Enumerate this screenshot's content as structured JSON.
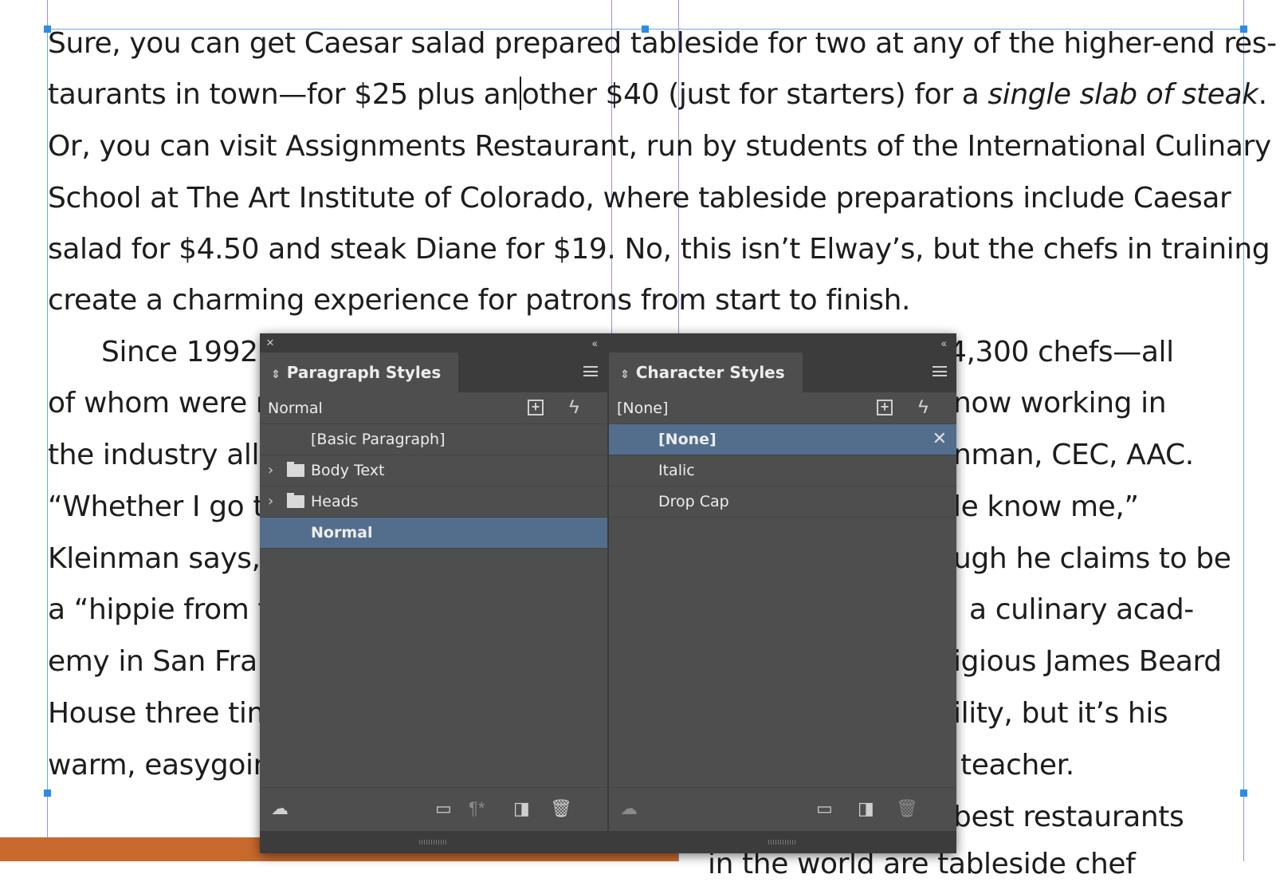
{
  "document": {
    "lines_top": [
      {
        "text": "Sure, you can get Caesar salad prepared tableside for two at any of the higher-end res-"
      },
      {
        "before": "taurants in town—for $25 plus an",
        "after": "other $40 (just for starters) for a ",
        "italic": "single slab of steak",
        "tail": "."
      },
      {
        "text": "Or, you can visit Assignments Restaurant, run by students of the International Culinary"
      },
      {
        "text": "School at The Art Institute of Colorado, where tableside preparations include Caesar"
      },
      {
        "text": "salad for $4.50 and steak Diane for $19. No, this isn’t Elway’s, but the chefs in training"
      },
      {
        "text": "create a charming experience for patrons from start to finish."
      }
    ],
    "lines_left": [
      "Since 1992,",
      "of whom were r",
      "the industry all",
      "“Whether I go t",
      "Kleinman says, c",
      "a “hippie from t",
      "emy in San Fran",
      "House three tim",
      "warm, easygoin"
    ],
    "lines_right": [
      "4,300 chefs—all",
      "now working in",
      "nman, CEC, AAC.",
      "le know me,”",
      "ugh he claims to be",
      "a culinary acad-",
      "igious James Beard",
      "ility, but it’s his",
      "teacher.",
      "best restaurants",
      "in the world are tableside chef"
    ]
  },
  "panels": {
    "close_glyph": "×",
    "collapse_glyph": "‹‹",
    "paragraph_styles": {
      "tab_label": "Paragraph Styles",
      "current_style": "Normal",
      "items": [
        {
          "label": "[Basic Paragraph]",
          "type": "style"
        },
        {
          "label": "Body Text",
          "type": "folder"
        },
        {
          "label": "Heads",
          "type": "folder"
        },
        {
          "label": "Normal",
          "type": "style",
          "selected": true
        }
      ]
    },
    "character_styles": {
      "tab_label": "Character Styles",
      "current_style": "[None]",
      "items": [
        {
          "label": "[None]",
          "type": "style",
          "selected": true
        },
        {
          "label": "Italic",
          "type": "style"
        },
        {
          "label": "Drop Cap",
          "type": "style"
        }
      ]
    }
  },
  "icons": {
    "updown": "⇕",
    "menu": "menu-icon",
    "new_group": "+",
    "quick_apply": "ϟ",
    "chevron": "›",
    "clear_overrides": "✕",
    "cloud": "☁",
    "folder": "▭",
    "pilcrow_clear": "¶*",
    "new_style": "◨",
    "trash": "🗑"
  },
  "colors": {
    "panel_bg": "#4e4e4e",
    "selected_row": "#536e8d",
    "accent_frame": "#2b8de6",
    "guide": "#a58be0",
    "page_strip": "#c8692d"
  }
}
